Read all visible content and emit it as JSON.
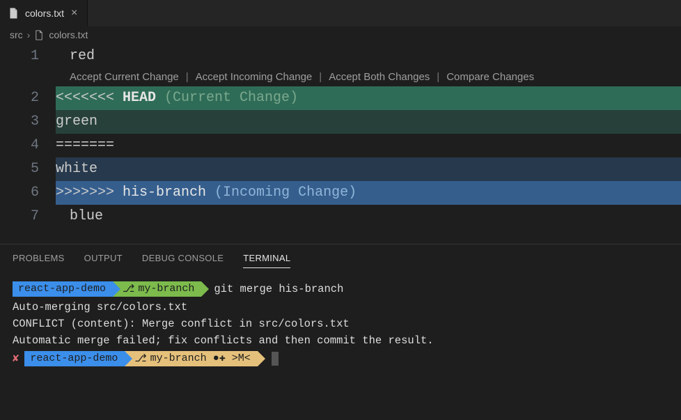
{
  "tab": {
    "filename": "colors.txt"
  },
  "breadcrumb": {
    "folder": "src",
    "file": "colors.txt"
  },
  "codelens": {
    "accept_current": "Accept Current Change",
    "accept_incoming": "Accept Incoming Change",
    "accept_both": "Accept Both Changes",
    "compare": "Compare Changes"
  },
  "editor": {
    "line1": {
      "num": "1",
      "text": "red"
    },
    "line2": {
      "num": "2",
      "marker": "<<<<<<< ",
      "head": "HEAD",
      "annot": " (Current Change)"
    },
    "line3": {
      "num": "3",
      "text": "green"
    },
    "line4": {
      "num": "4",
      "text": "======="
    },
    "line5": {
      "num": "5",
      "text": "white"
    },
    "line6": {
      "num": "6",
      "marker": ">>>>>>> ",
      "branch": "his-branch",
      "annot": " (Incoming Change)"
    },
    "line7": {
      "num": "7",
      "text": "blue"
    }
  },
  "panel_tabs": {
    "problems": "PROBLEMS",
    "output": "OUTPUT",
    "debug": "DEBUG CONSOLE",
    "terminal": "TERMINAL"
  },
  "terminal": {
    "prompt1_dir": "react-app-demo",
    "prompt1_branch": "my-branch",
    "prompt1_cmd": "git merge his-branch",
    "out1": "Auto-merging src/colors.txt",
    "out2": "CONFLICT (content): Merge conflict in src/colors.txt",
    "out3": "Automatic merge failed; fix conflicts and then commit the result.",
    "prompt2_x": "✘",
    "prompt2_dir": "react-app-demo",
    "prompt2_branch": "my-branch ●✚ >M<"
  }
}
